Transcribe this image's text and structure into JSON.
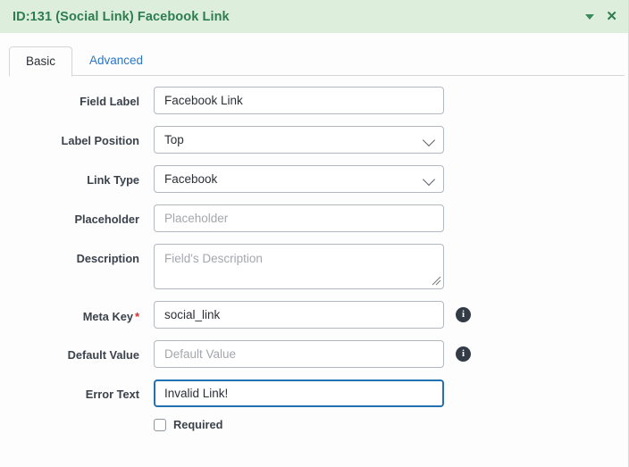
{
  "header": {
    "title": "ID:131 (Social Link) Facebook Link",
    "collapse_icon": "chevron-down-icon",
    "close_icon": "close-icon",
    "close_glyph": "✕",
    "bg_color": "#ddeedd",
    "text_color": "#2e7d4f"
  },
  "tabs": [
    {
      "label": "Basic",
      "active": true
    },
    {
      "label": "Advanced",
      "active": false
    }
  ],
  "form": {
    "field_label": {
      "label": "Field Label",
      "value": "Facebook Link",
      "placeholder": ""
    },
    "label_position": {
      "label": "Label Position",
      "value": "Top"
    },
    "link_type": {
      "label": "Link Type",
      "value": "Facebook"
    },
    "placeholder_field": {
      "label": "Placeholder",
      "value": "",
      "placeholder": "Placeholder"
    },
    "description": {
      "label": "Description",
      "value": "",
      "placeholder": "Field's Description"
    },
    "meta_key": {
      "label": "Meta Key",
      "required_marker": "*",
      "value": "social_link",
      "info_icon": "info-icon",
      "info_glyph": "i"
    },
    "default_value": {
      "label": "Default Value",
      "value": "",
      "placeholder": "Default Value",
      "info_icon": "info-icon",
      "info_glyph": "i"
    },
    "error_text": {
      "label": "Error Text",
      "value": "Invalid Link!",
      "placeholder": "",
      "focus_color": "#2271b1"
    },
    "required_checkbox": {
      "label": "Required",
      "checked": false
    }
  },
  "colors": {
    "accent_green": "#2e7d4f",
    "link_blue": "#2b77c4",
    "focus_blue": "#2271b1",
    "required_red": "#e02b2b",
    "page_bg": "#fcfdfc"
  }
}
